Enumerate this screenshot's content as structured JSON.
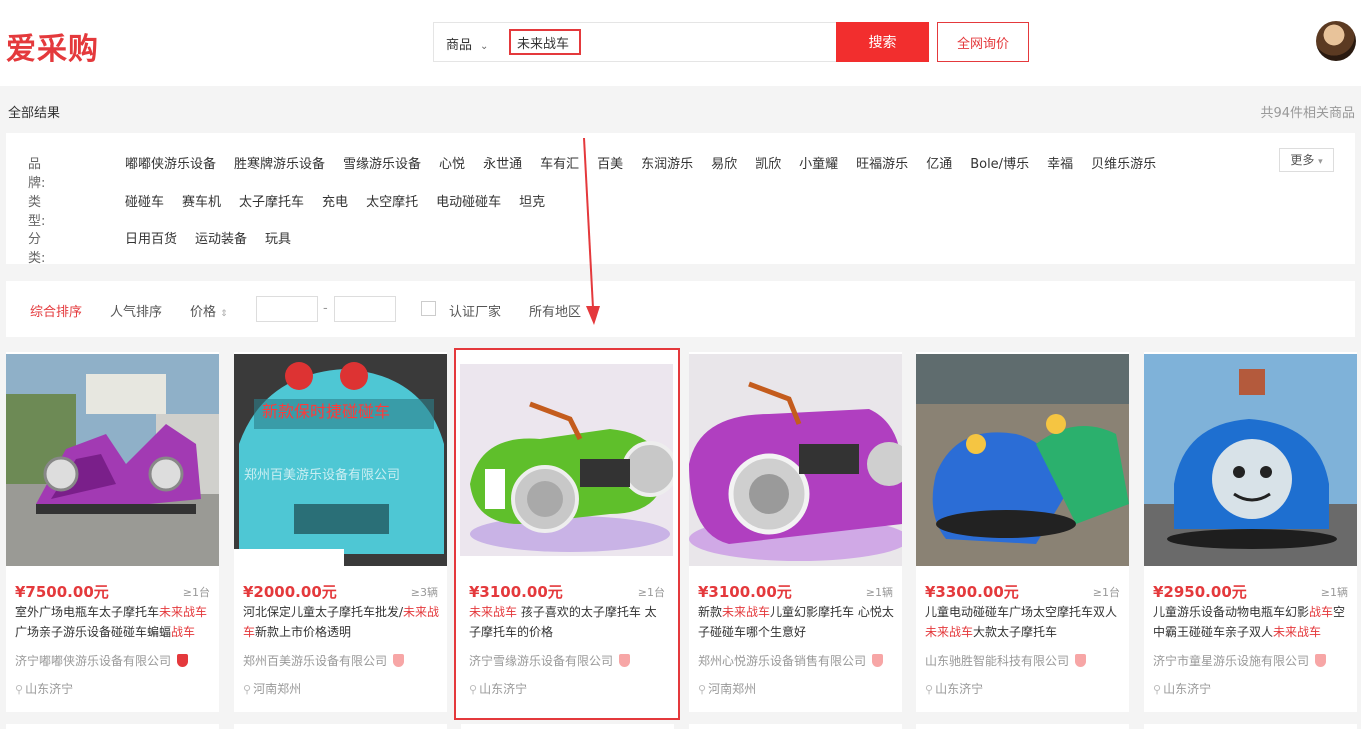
{
  "header": {
    "logo": "爱采购",
    "search_type": "商品",
    "search_query": "未来战车",
    "search_button": "搜索",
    "inquiry_button": "全网询价"
  },
  "results": {
    "all_label": "全部结果",
    "count_text": "共94件相关商品"
  },
  "filters": {
    "brand": {
      "label": "品牌:",
      "items": [
        "嘟嘟侠游乐设备",
        "胜寒牌游乐设备",
        "雪缘游乐设备",
        "心悦",
        "永世通",
        "车有汇",
        "百美",
        "东润游乐",
        "易欣",
        "凯欣",
        "小童耀",
        "旺福游乐",
        "亿通",
        "Bole/博乐",
        "幸福",
        "贝维乐游乐"
      ]
    },
    "type": {
      "label": "类型:",
      "items": [
        "碰碰车",
        "赛车机",
        "太子摩托车",
        "充电",
        "太空摩托",
        "电动碰碰车",
        "坦克"
      ]
    },
    "category": {
      "label": "分类:",
      "items": [
        "日用百货",
        "运动装备",
        "玩具"
      ]
    },
    "more": "更多"
  },
  "sort": {
    "comprehensive": "综合排序",
    "popularity": "人气排序",
    "price": "价格",
    "price_sort_icon": "updown-arrows-icon",
    "certified": "认证厂家",
    "region": "所有地区"
  },
  "products": [
    {
      "price": "¥7500.00元",
      "qty": "≥1台",
      "title_parts": [
        "室外广场电瓶车太子摩托车",
        "未来战车",
        "广场亲子游乐设备碰碰车蝙蝠",
        "战车",
        ""
      ],
      "seller": "济宁嘟嘟侠游乐设备有限公司",
      "location": "山东济宁",
      "highlighted": false
    },
    {
      "price": "¥2000.00元",
      "qty": "≥3辆",
      "title_parts": [
        "河北保定儿童太子摩托车批发/",
        "未来战车",
        "新款上市价格透明",
        "",
        ""
      ],
      "seller": "郑州百美游乐设备有限公司",
      "location": "河南郑州",
      "highlighted": false
    },
    {
      "price": "¥3100.00元",
      "qty": "≥1台",
      "title_parts": [
        "",
        "未来战车",
        " 孩子喜欢的太子摩托车 太子摩托车的价格",
        "",
        ""
      ],
      "seller": "济宁雪缘游乐设备有限公司",
      "location": "山东济宁",
      "highlighted": true
    },
    {
      "price": "¥3100.00元",
      "qty": "≥1辆",
      "title_parts": [
        "新款",
        "未来战车",
        "儿童幻影摩托车 心悦太子碰碰车哪个生意好",
        "",
        ""
      ],
      "seller": "郑州心悦游乐设备销售有限公司",
      "location": "河南郑州",
      "highlighted": false
    },
    {
      "price": "¥3300.00元",
      "qty": "≥1台",
      "title_parts": [
        "儿童电动碰碰车广场太空摩托车双人",
        "未来战车",
        "大款太子摩托车",
        "",
        ""
      ],
      "seller": "山东驰胜智能科技有限公司",
      "location": "山东济宁",
      "highlighted": false
    },
    {
      "price": "¥2950.00元",
      "qty": "≥1辆",
      "title_parts": [
        "儿童游乐设备动物电瓶车幻影",
        "战车",
        "空中霸王碰碰车亲子双人",
        "未来战车",
        ""
      ],
      "seller": "济宁市童星游乐设施有限公司",
      "location": "山东济宁",
      "highlighted": false
    }
  ],
  "colors": {
    "accent": "#e4393c",
    "search_button": "#f22e2e",
    "page_background": "#f4f4f4"
  }
}
